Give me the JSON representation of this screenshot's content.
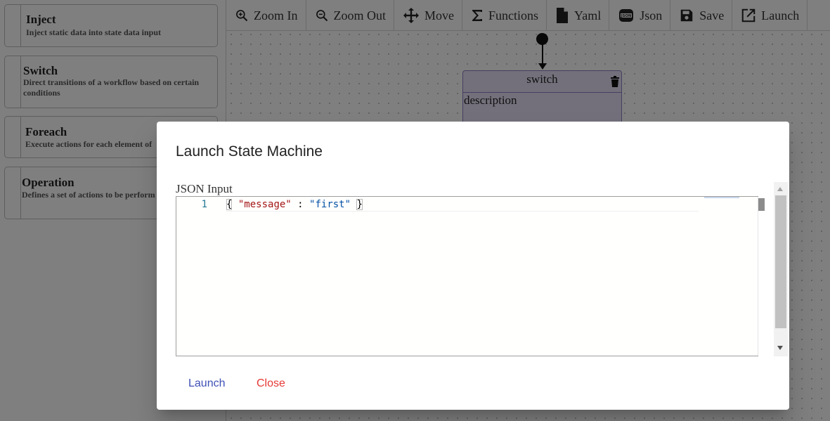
{
  "palette": {
    "items": [
      {
        "title": "Inject",
        "description": "Inject static data into state data input"
      },
      {
        "title": "Switch",
        "description": "Direct transitions of a workflow based on certain conditions"
      },
      {
        "title": "Foreach",
        "description": "Execute actions for each element of"
      },
      {
        "title": "Operation",
        "description": "Defines a set of actions to be perform or in parallel."
      }
    ]
  },
  "toolbar": {
    "zoom_in": "Zoom In",
    "zoom_out": "Zoom Out",
    "move": "Move",
    "functions": "Functions",
    "yaml": "Yaml",
    "json": "Json",
    "save": "Save",
    "launch": "Launch"
  },
  "diagram": {
    "state_name": "switch",
    "state_description": "description"
  },
  "dialog": {
    "title": "Launch State Machine",
    "input_label": "JSON Input",
    "line_number": "1",
    "code": {
      "open": "{",
      "key": "\"message\"",
      "colon": " : ",
      "value": "\"first\"",
      "close": "}"
    },
    "launch_label": "Launch",
    "close_label": "Close"
  },
  "colors": {
    "primary": "#3f51b5",
    "danger": "#e53935",
    "state_fill": "#e7e0f6"
  }
}
